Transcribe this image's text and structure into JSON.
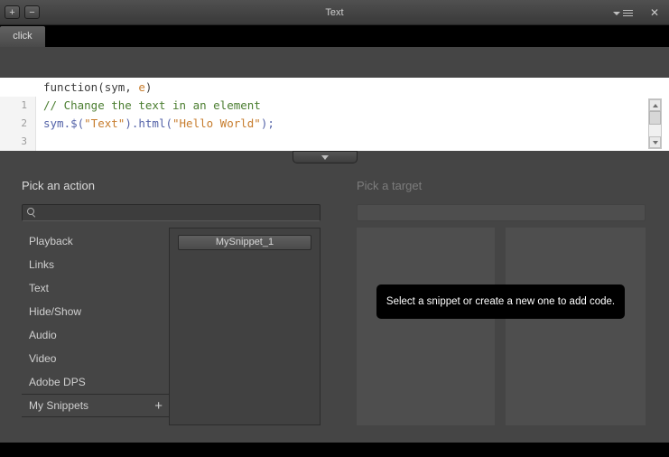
{
  "titlebar": {
    "title": "Text",
    "add_label": "+",
    "remove_label": "−",
    "close_label": "✕"
  },
  "tabs": {
    "click_label": "click"
  },
  "code": {
    "signature": {
      "pre": "function(sym, ",
      "param": "e",
      "post": ")"
    },
    "line_numbers": [
      "1",
      "2",
      "3"
    ],
    "line1_comment": "// Change the text in an element",
    "line2": {
      "t1": "sym.$(",
      "t2": "\"Text\"",
      "t3": ").html(",
      "t4": "\"Hello World\"",
      "t5": ");"
    }
  },
  "action_panel": {
    "label": "Pick an action",
    "search_value": "",
    "items": [
      "Playback",
      "Links",
      "Text",
      "Hide/Show",
      "Audio",
      "Video",
      "Adobe DPS",
      "My Snippets"
    ],
    "add_snippet_label": "+",
    "snippets": {
      "snippet1_label": "MySnippet_1"
    }
  },
  "target_panel": {
    "label": "Pick a target",
    "tooltip": "Select a snippet or create a new one to add code."
  },
  "colors": {
    "syntax_comment": "#4a7d2f",
    "syntax_string": "#c77d2e",
    "syntax_code": "#5463a8",
    "syntax_default": "#3d3d3d",
    "panel_bg": "#454545",
    "editor_bg": "#ffffff",
    "tooltip_bg": "#000000"
  }
}
